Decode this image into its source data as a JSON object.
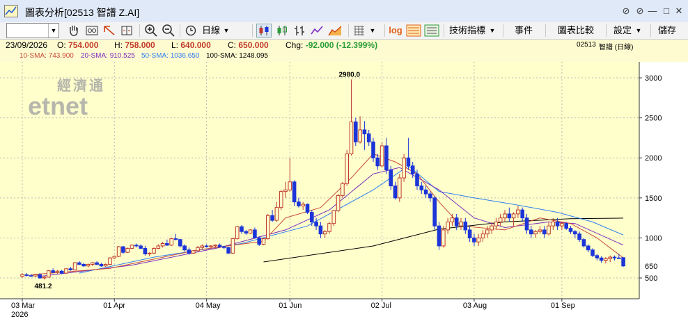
{
  "window": {
    "title": "圖表分析[02513 智譜 Z.AI]",
    "controls": [
      "⊘",
      "⊘",
      "—",
      "□",
      "✕"
    ]
  },
  "toolbar": {
    "period_label": "日線",
    "log_label": "log",
    "indicators_label": "技術指標",
    "events_label": "事件",
    "compare_label": "圖表比較",
    "settings_label": "設定",
    "save_label": "儲存"
  },
  "info": {
    "date": "23/09/2026",
    "open_label": "O:",
    "open": "754.000",
    "high_label": "H:",
    "high": "758.000",
    "low_label": "L:",
    "low": "640.000",
    "close_label": "C:",
    "close": "650.000",
    "chg_label": "Chg:",
    "chg": "-92.000 (-12.399%)",
    "symbol": "02513",
    "name": "智譜 (日線)"
  },
  "sma": {
    "sma10_label": "10-SMA:",
    "sma10": "743.900",
    "sma10_color": "#c94a3b",
    "sma20_label": "20-SMA:",
    "sma20": "910.525",
    "sma20_color": "#7a2bbf",
    "sma50_label": "50-SMA:",
    "sma50": "1036.650",
    "sma50_color": "#2f7ff0",
    "sma100_label": "100-SMA:",
    "sma100": "1248.095",
    "sma100_color": "#000000"
  },
  "watermark": {
    "top": "經濟通",
    "bottom": "etnet"
  },
  "colors": {
    "up": "#c0392b",
    "down": "#1c35d8",
    "plot_bg": "#ffffcc"
  },
  "chart_data": {
    "type": "candlestick",
    "y_ticks": [
      500,
      1000,
      1500,
      2000,
      2500,
      3000
    ],
    "ylim": [
      240,
      3200
    ],
    "x_labels": [
      {
        "label": "03 Mar",
        "sub": "2026",
        "i": 0
      },
      {
        "label": "01 Apr",
        "i": 21
      },
      {
        "label": "04 May",
        "i": 42
      },
      {
        "label": "01 Jun",
        "i": 61
      },
      {
        "label": "02 Jul",
        "i": 82
      },
      {
        "label": "03 Aug",
        "i": 103
      },
      {
        "label": "01 Sep",
        "i": 123
      }
    ],
    "last_close_label": "650",
    "max_label": "2980.0",
    "min_label": "481.2",
    "ohlc": [
      [
        520,
        560,
        500,
        540
      ],
      [
        540,
        560,
        520,
        530
      ],
      [
        530,
        545,
        515,
        525
      ],
      [
        525,
        550,
        510,
        540
      ],
      [
        540,
        560,
        490,
        500
      ],
      [
        500,
        520,
        481.2,
        510
      ],
      [
        510,
        600,
        505,
        590
      ],
      [
        590,
        620,
        560,
        570
      ],
      [
        570,
        600,
        550,
        585
      ],
      [
        585,
        600,
        555,
        560
      ],
      [
        560,
        620,
        555,
        615
      ],
      [
        615,
        640,
        590,
        600
      ],
      [
        600,
        700,
        595,
        690
      ],
      [
        690,
        710,
        660,
        670
      ],
      [
        670,
        690,
        640,
        650
      ],
      [
        650,
        680,
        630,
        670
      ],
      [
        670,
        700,
        650,
        690
      ],
      [
        690,
        710,
        660,
        670
      ],
      [
        670,
        690,
        640,
        650
      ],
      [
        650,
        680,
        640,
        670
      ],
      [
        670,
        760,
        660,
        750
      ],
      [
        750,
        780,
        740,
        770
      ],
      [
        770,
        900,
        760,
        890
      ],
      [
        890,
        900,
        800,
        820
      ],
      [
        820,
        880,
        810,
        870
      ],
      [
        870,
        920,
        860,
        910
      ],
      [
        910,
        930,
        880,
        900
      ],
      [
        900,
        920,
        860,
        870
      ],
      [
        870,
        900,
        780,
        800
      ],
      [
        800,
        820,
        770,
        810
      ],
      [
        810,
        880,
        800,
        870
      ],
      [
        870,
        920,
        860,
        900
      ],
      [
        900,
        950,
        880,
        930
      ],
      [
        930,
        980,
        900,
        910
      ],
      [
        910,
        1000,
        900,
        990
      ],
      [
        990,
        1050,
        970,
        980
      ],
      [
        980,
        990,
        880,
        900
      ],
      [
        900,
        920,
        830,
        850
      ],
      [
        850,
        880,
        790,
        810
      ],
      [
        810,
        850,
        800,
        840
      ],
      [
        840,
        900,
        830,
        880
      ],
      [
        880,
        920,
        860,
        900
      ],
      [
        900,
        920,
        880,
        890
      ],
      [
        890,
        910,
        870,
        900
      ],
      [
        900,
        920,
        880,
        910
      ],
      [
        910,
        930,
        880,
        890
      ],
      [
        890,
        900,
        860,
        880
      ],
      [
        880,
        890,
        800,
        810
      ],
      [
        810,
        1000,
        800,
        990
      ],
      [
        990,
        1150,
        980,
        1140
      ],
      [
        1140,
        1160,
        1050,
        1080
      ],
      [
        1080,
        1100,
        1040,
        1060
      ],
      [
        1060,
        1110,
        1050,
        1100
      ],
      [
        1100,
        1130,
        990,
        1000
      ],
      [
        1000,
        1020,
        900,
        920
      ],
      [
        920,
        1000,
        910,
        990
      ],
      [
        990,
        1300,
        980,
        1280
      ],
      [
        1280,
        1350,
        1200,
        1220
      ],
      [
        1220,
        1450,
        1200,
        1380
      ],
      [
        1380,
        1600,
        1350,
        1580
      ],
      [
        1580,
        1700,
        1500,
        1600
      ],
      [
        1600,
        2000,
        1580,
        1700
      ],
      [
        1700,
        1720,
        1400,
        1450
      ],
      [
        1450,
        1500,
        1380,
        1400
      ],
      [
        1400,
        1450,
        1350,
        1420
      ],
      [
        1420,
        1430,
        1300,
        1320
      ],
      [
        1320,
        1350,
        1150,
        1200
      ],
      [
        1200,
        1250,
        1100,
        1150
      ],
      [
        1150,
        1200,
        1000,
        1050
      ],
      [
        1050,
        1100,
        1000,
        1080
      ],
      [
        1080,
        1200,
        1050,
        1180
      ],
      [
        1180,
        1350,
        1150,
        1340
      ],
      [
        1340,
        1550,
        1320,
        1530
      ],
      [
        1530,
        1700,
        1500,
        1680
      ],
      [
        1680,
        2100,
        1650,
        2050
      ],
      [
        2050,
        2980,
        2030,
        2450
      ],
      [
        2450,
        2500,
        2150,
        2200
      ],
      [
        2200,
        2520,
        2180,
        2350
      ],
      [
        2350,
        2460,
        2100,
        2300
      ],
      [
        2300,
        2350,
        2150,
        2200
      ],
      [
        2200,
        2250,
        1950,
        2000
      ],
      [
        2000,
        2050,
        1850,
        1900
      ],
      [
        1900,
        2200,
        1880,
        2150
      ],
      [
        2150,
        2250,
        1800,
        1850
      ],
      [
        1850,
        1900,
        1600,
        1650
      ],
      [
        1650,
        1700,
        1480,
        1500
      ],
      [
        1500,
        1800,
        1450,
        1750
      ],
      [
        1750,
        2050,
        1700,
        2000
      ],
      [
        2000,
        2250,
        1850,
        1900
      ],
      [
        1900,
        1950,
        1750,
        1800
      ],
      [
        1800,
        1850,
        1600,
        1650
      ],
      [
        1650,
        1700,
        1550,
        1600
      ],
      [
        1600,
        1650,
        1500,
        1550
      ],
      [
        1550,
        1580,
        1450,
        1500
      ],
      [
        1500,
        1520,
        1100,
        1150
      ],
      [
        1150,
        1200,
        850,
        900
      ],
      [
        900,
        1150,
        880,
        1100
      ],
      [
        1100,
        1250,
        1050,
        1200
      ],
      [
        1200,
        1300,
        1150,
        1250
      ],
      [
        1250,
        1300,
        1100,
        1150
      ],
      [
        1150,
        1250,
        1100,
        1200
      ],
      [
        1200,
        1250,
        1050,
        1100
      ],
      [
        1100,
        1150,
        950,
        1000
      ],
      [
        1000,
        1050,
        900,
        950
      ],
      [
        950,
        1050,
        900,
        1000
      ],
      [
        1000,
        1100,
        950,
        1050
      ],
      [
        1050,
        1150,
        1000,
        1100
      ],
      [
        1100,
        1200,
        1050,
        1150
      ],
      [
        1150,
        1250,
        1100,
        1200
      ],
      [
        1200,
        1300,
        1150,
        1250
      ],
      [
        1250,
        1350,
        1200,
        1300
      ],
      [
        1300,
        1380,
        1200,
        1250
      ],
      [
        1250,
        1320,
        1150,
        1300
      ],
      [
        1300,
        1400,
        1250,
        1350
      ],
      [
        1350,
        1380,
        1200,
        1250
      ],
      [
        1250,
        1300,
        1050,
        1100
      ],
      [
        1100,
        1150,
        1000,
        1050
      ],
      [
        1050,
        1100,
        1000,
        1080
      ],
      [
        1080,
        1150,
        1050,
        1100
      ],
      [
        1100,
        1150,
        1000,
        1050
      ],
      [
        1050,
        1200,
        1030,
        1150
      ],
      [
        1150,
        1250,
        1100,
        1200
      ],
      [
        1200,
        1250,
        1100,
        1150
      ],
      [
        1150,
        1200,
        1100,
        1180
      ],
      [
        1180,
        1200,
        1100,
        1120
      ],
      [
        1120,
        1150,
        1050,
        1080
      ],
      [
        1080,
        1100,
        1000,
        1050
      ],
      [
        1050,
        1080,
        950,
        980
      ],
      [
        980,
        1000,
        880,
        900
      ],
      [
        900,
        920,
        820,
        850
      ],
      [
        850,
        870,
        760,
        780
      ],
      [
        780,
        800,
        720,
        750
      ],
      [
        750,
        770,
        690,
        720
      ],
      [
        720,
        760,
        680,
        740
      ],
      [
        740,
        780,
        700,
        760
      ],
      [
        760,
        780,
        720,
        750
      ],
      [
        750,
        800,
        740,
        742
      ],
      [
        754,
        758,
        640,
        650
      ]
    ],
    "sma10": [
      [
        2,
        540
      ],
      [
        20,
        620
      ],
      [
        40,
        850
      ],
      [
        55,
        960
      ],
      [
        60,
        1250
      ],
      [
        68,
        1380
      ],
      [
        75,
        1750
      ],
      [
        80,
        2050
      ],
      [
        85,
        1950
      ],
      [
        90,
        1800
      ],
      [
        95,
        1450
      ],
      [
        100,
        1150
      ],
      [
        110,
        1100
      ],
      [
        118,
        1250
      ],
      [
        125,
        1180
      ],
      [
        131,
        1000
      ],
      [
        137,
        750
      ]
    ],
    "sma20": [
      [
        4,
        520
      ],
      [
        25,
        660
      ],
      [
        45,
        880
      ],
      [
        60,
        1100
      ],
      [
        70,
        1350
      ],
      [
        80,
        1800
      ],
      [
        86,
        1880
      ],
      [
        95,
        1600
      ],
      [
        103,
        1250
      ],
      [
        110,
        1130
      ],
      [
        120,
        1200
      ],
      [
        126,
        1180
      ],
      [
        137,
        910
      ]
    ],
    "sma50": [
      [
        13,
        560
      ],
      [
        30,
        760
      ],
      [
        50,
        930
      ],
      [
        65,
        1150
      ],
      [
        80,
        1600
      ],
      [
        88,
        1900
      ],
      [
        95,
        1580
      ],
      [
        103,
        1500
      ],
      [
        112,
        1420
      ],
      [
        122,
        1320
      ],
      [
        130,
        1200
      ],
      [
        137,
        1037
      ]
    ],
    "sma100": [
      [
        55,
        700
      ],
      [
        80,
        900
      ],
      [
        95,
        1110
      ],
      [
        110,
        1200
      ],
      [
        125,
        1240
      ],
      [
        137,
        1248
      ]
    ]
  }
}
